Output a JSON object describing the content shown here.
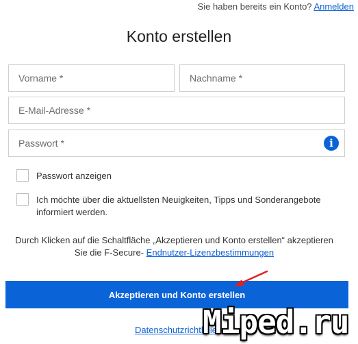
{
  "header": {
    "login_prompt": "Sie haben bereits ein Konto?",
    "login_link": "Anmelden"
  },
  "title": "Konto erstellen",
  "form": {
    "first_name_placeholder": "Vorname *",
    "last_name_placeholder": "Nachname *",
    "email_placeholder": "E-Mail-Adresse *",
    "password_placeholder": "Passwort *",
    "info_icon": "i",
    "show_password_label": "Passwort anzeigen",
    "newsletter_label": "Ich möchte über die aktuellsten Neuigkeiten, Tipps und Sonderangebote informiert werden."
  },
  "terms": {
    "line1": "Durch Klicken auf die Schaltfläche „Akzeptieren und Konto erstellen“ akzeptieren",
    "line2_prefix": "Sie die F-Secure-",
    "link": "Endnutzer-Lizenzbestimmungen"
  },
  "accept_button": "Akzeptieren und Konto erstellen",
  "privacy_link": "Datenschutzrichtlinie",
  "watermark": "Miped.ru",
  "colors": {
    "accent": "#0b63d8",
    "link": "#0b61d6",
    "arrow": "#e02020"
  }
}
